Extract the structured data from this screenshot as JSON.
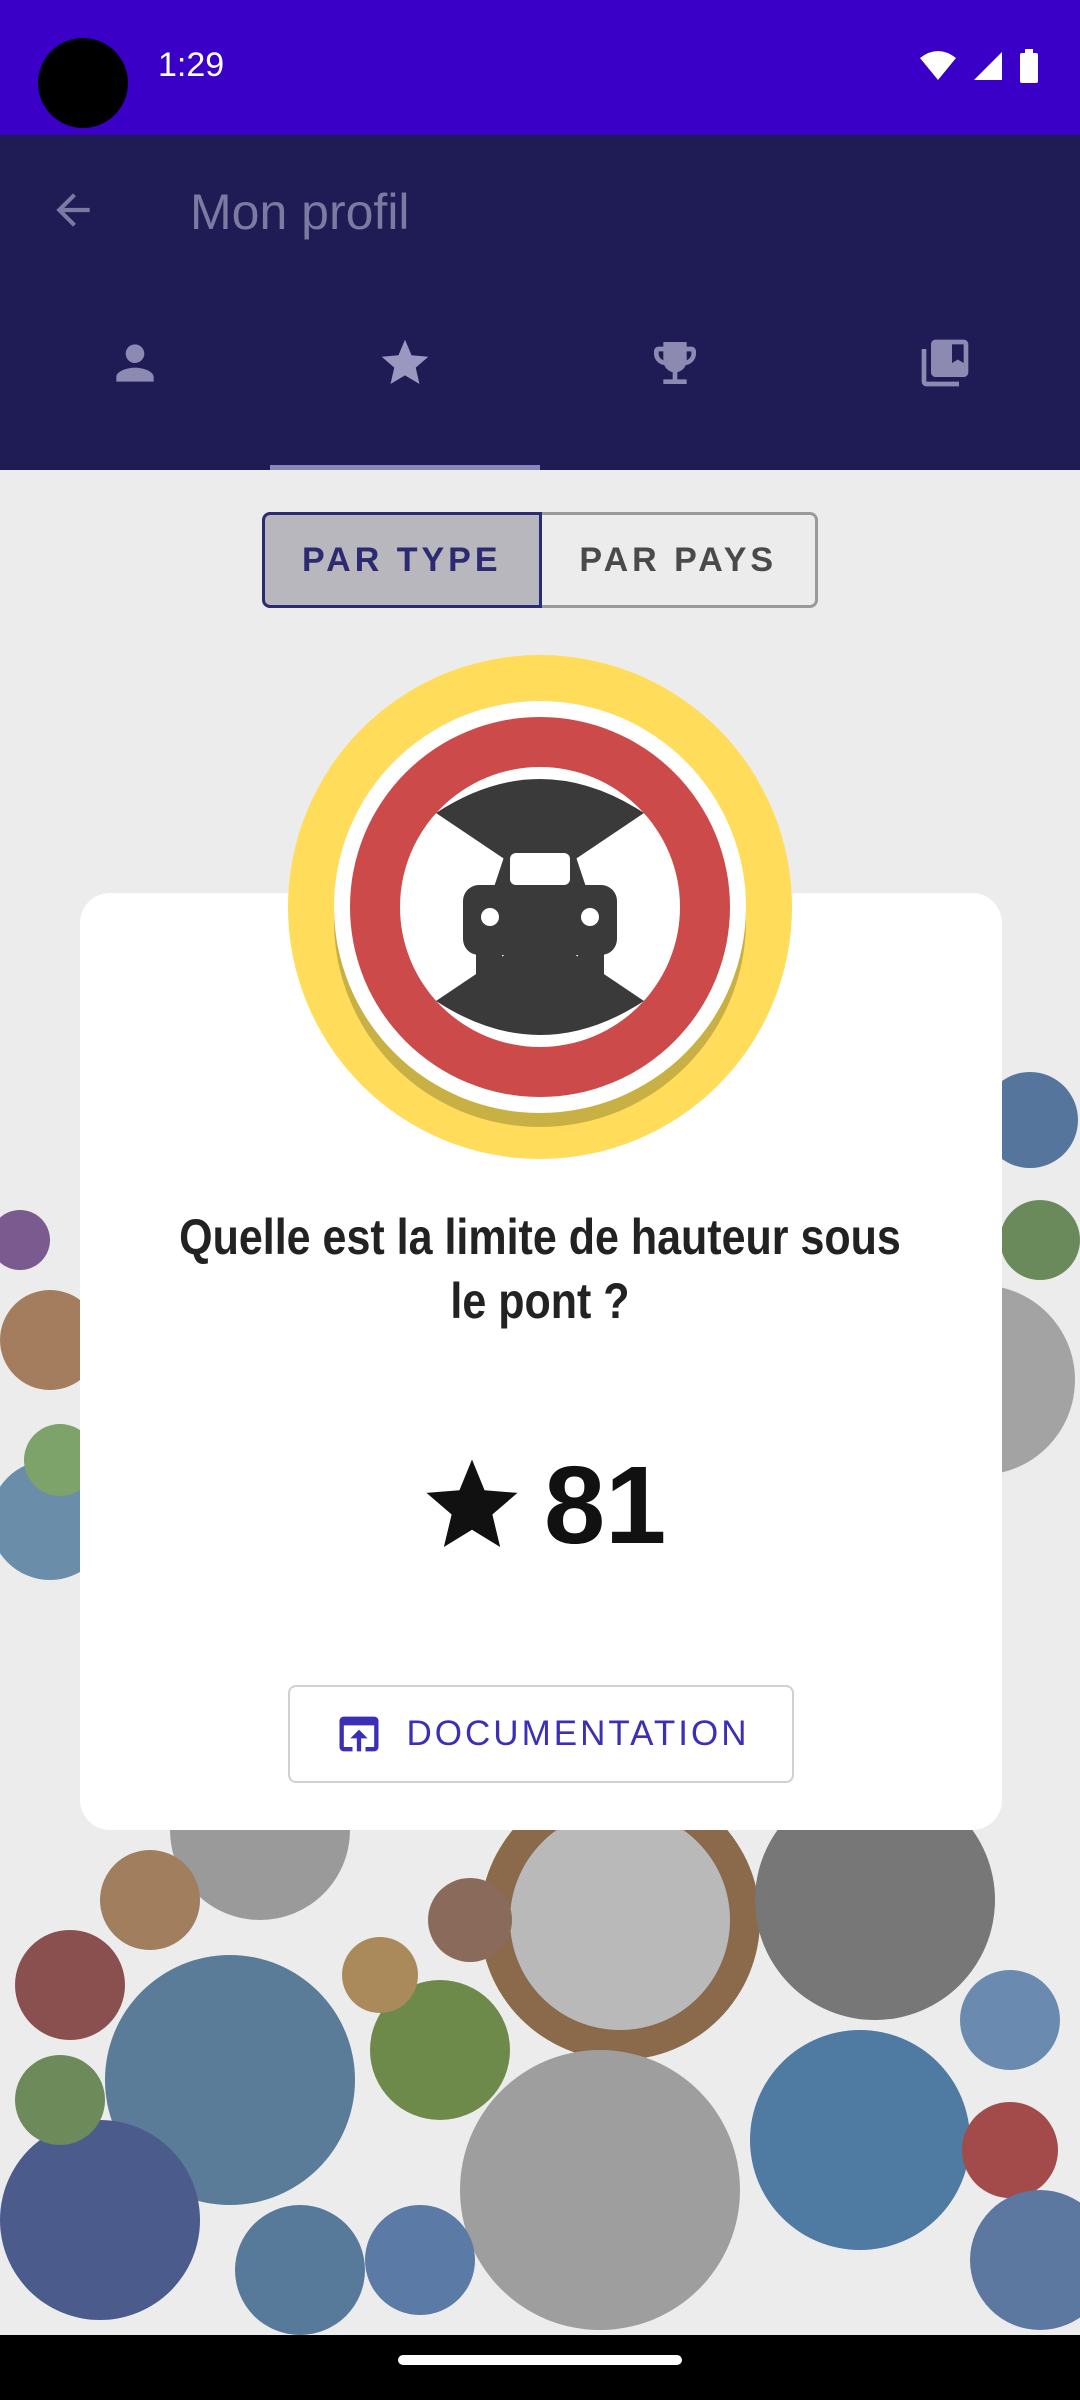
{
  "status": {
    "time": "1:29",
    "icons": [
      "wifi-icon",
      "signal-icon",
      "battery-icon"
    ]
  },
  "app_bar": {
    "title": "Mon profil",
    "tabs": [
      "person-icon",
      "star-icon",
      "trophy-icon",
      "collections-icon"
    ],
    "selected_tab": 1
  },
  "filter": {
    "options": [
      "PAR TYPE",
      "PAR PAYS"
    ],
    "selected": "PAR TYPE"
  },
  "dialog": {
    "badge_icon": "max-height-sign-icon",
    "question": "Quelle est la limite de hauteur sous le pont ?",
    "star_icon": "star-icon",
    "score": "81",
    "doc_button": "DOCUMENTATION",
    "doc_icon": "open-in-browser-icon"
  },
  "colors": {
    "status_bar": "#3b00c7",
    "app_bar": "#1e1b55",
    "accent": "#3b2fb8",
    "badge_ring": "#ffdc5a",
    "sign_red": "#cc4a4a"
  }
}
